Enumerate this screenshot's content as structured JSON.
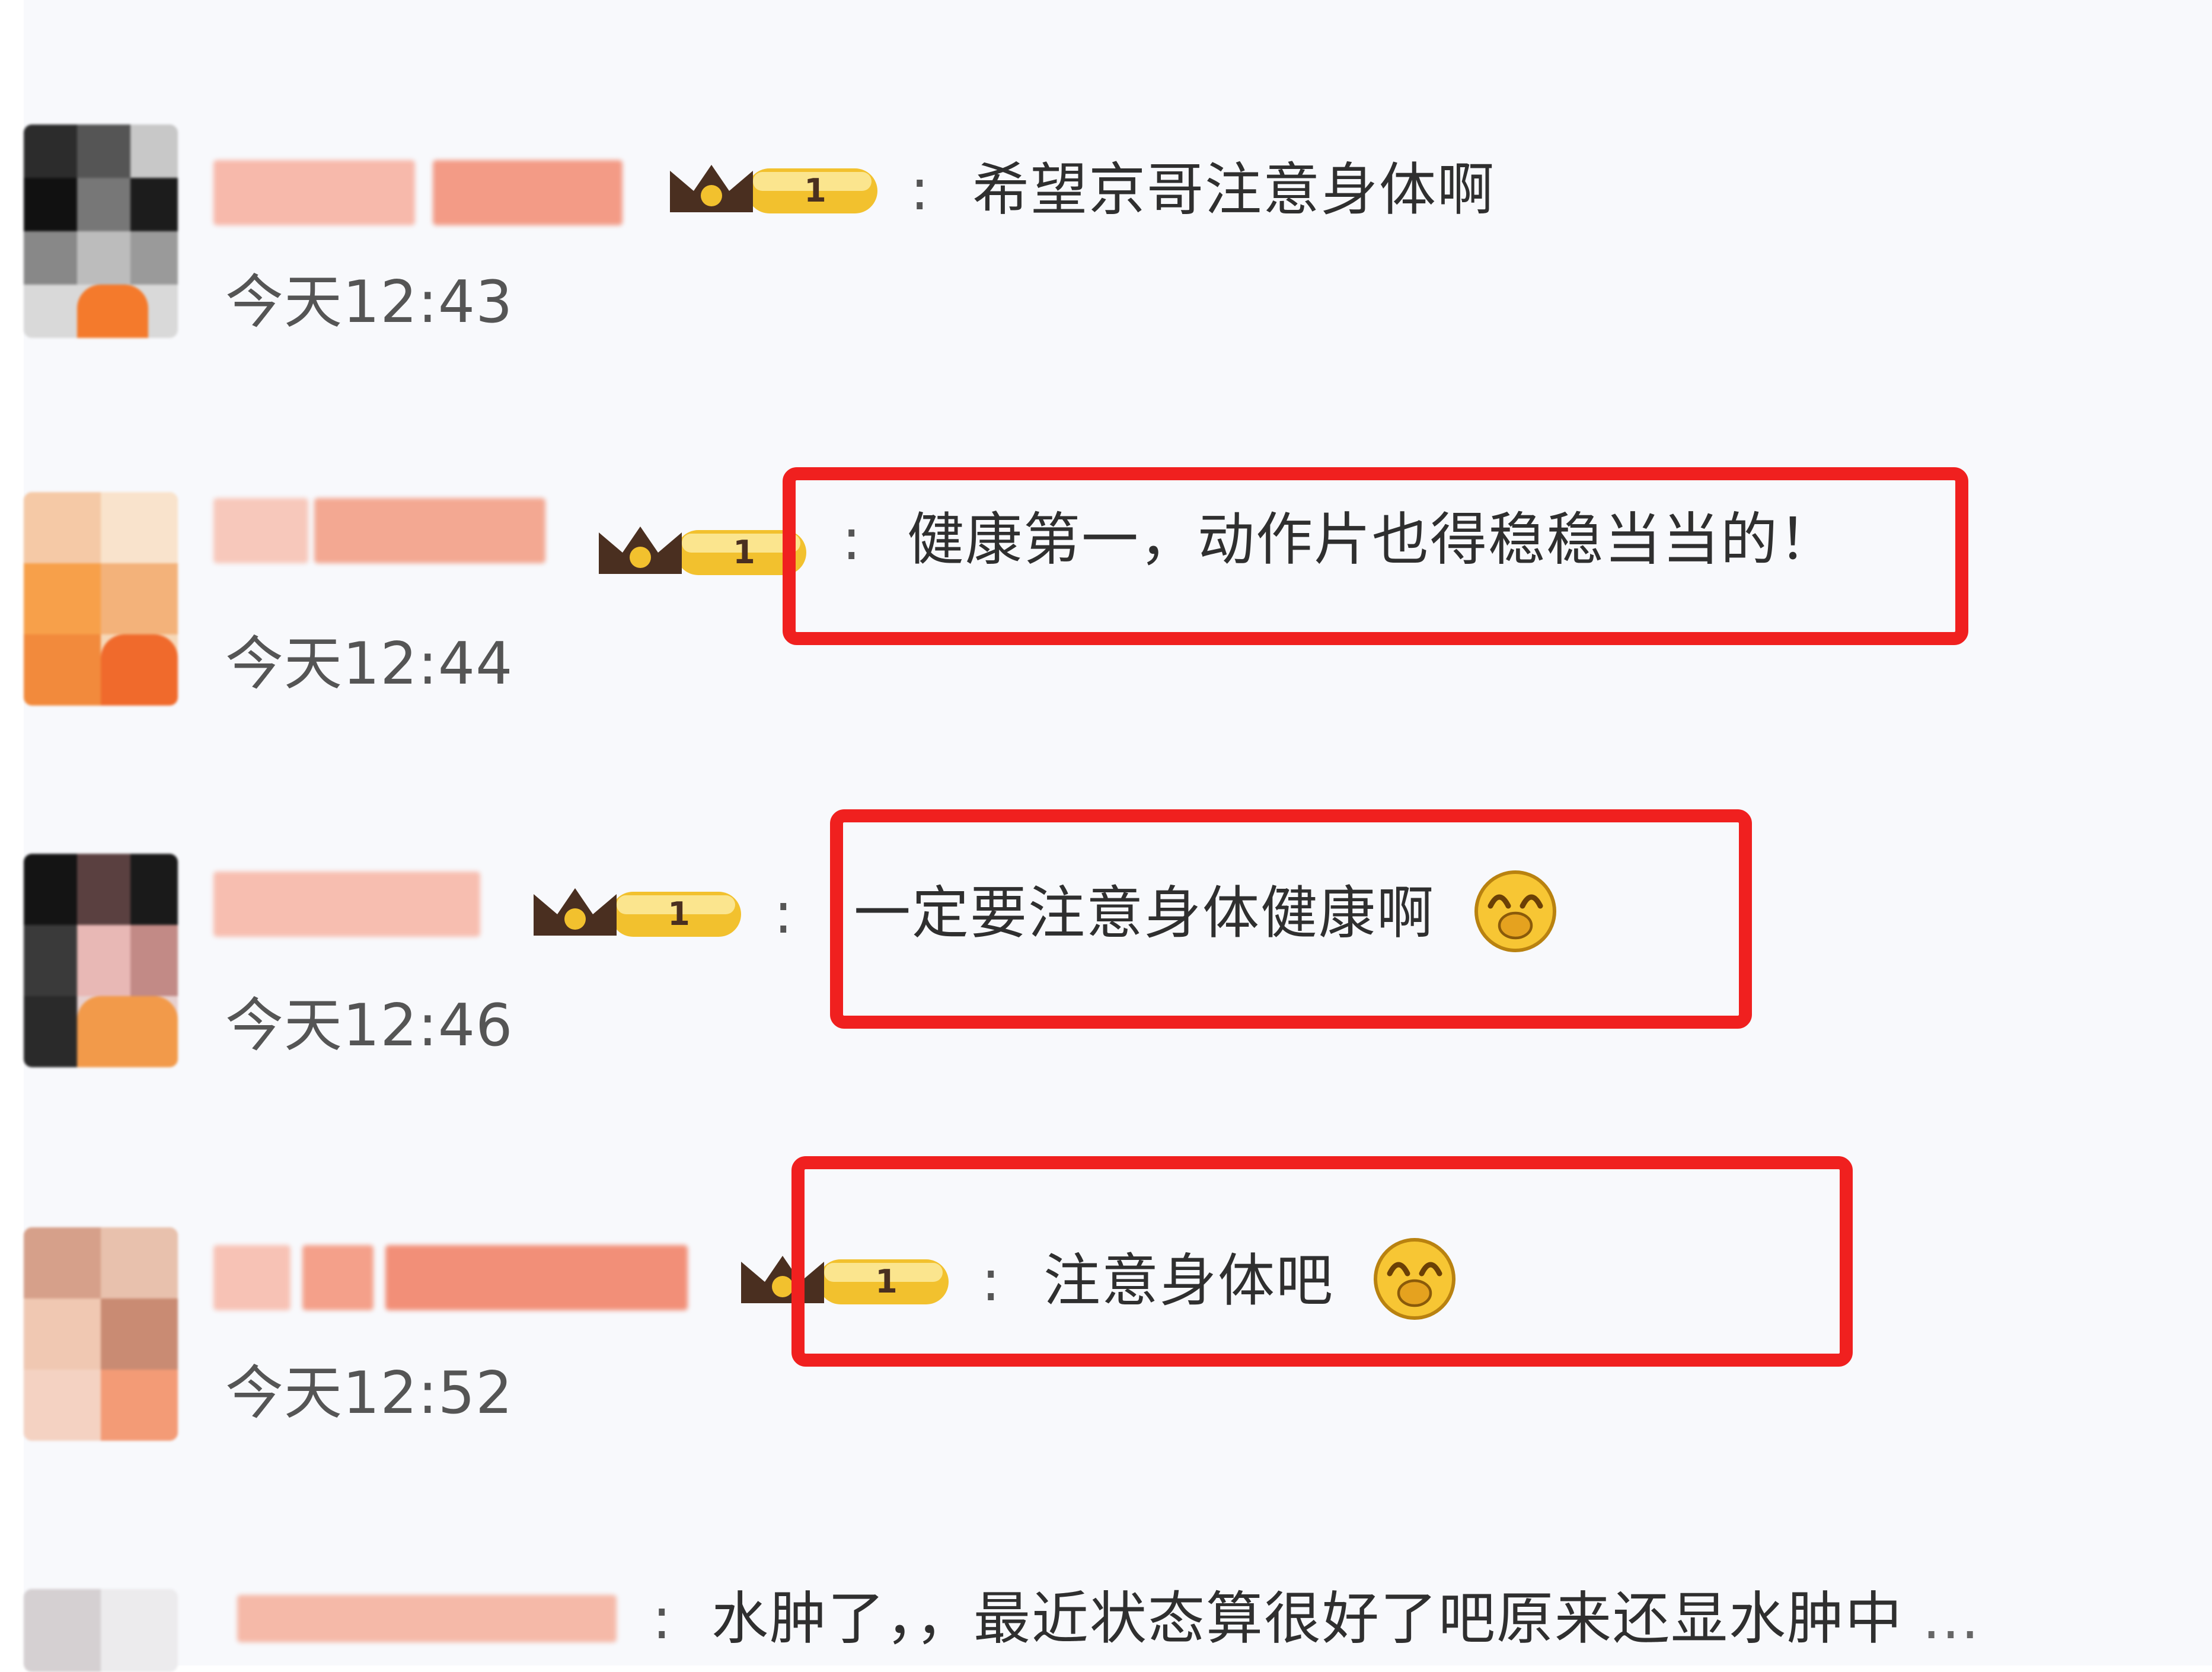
{
  "comments": [
    {
      "text": "希望京哥注意身体啊",
      "time": "今天12:43"
    },
    {
      "text": "健康第一，动作片也得稳稳当当的！",
      "time": "今天12:44"
    },
    {
      "text": "一定要注意身体健康啊",
      "time": "今天12:46"
    },
    {
      "text": "注意身体吧",
      "time": "今天12:52"
    },
    {
      "text": "水肿了，，最近状态算很好了吧原来还显水肿中",
      "ellipsis": "..."
    }
  ],
  "separator": ":",
  "badge": {
    "level": "1",
    "icon": "crown-icon"
  },
  "emoji": {
    "name": "smile-emoji-icon"
  },
  "colors": {
    "highlight": "#f0201f",
    "badge_gold": "#f2c12e",
    "crown_brown": "#4a2f20",
    "username_blur": "#f5b5a6"
  }
}
